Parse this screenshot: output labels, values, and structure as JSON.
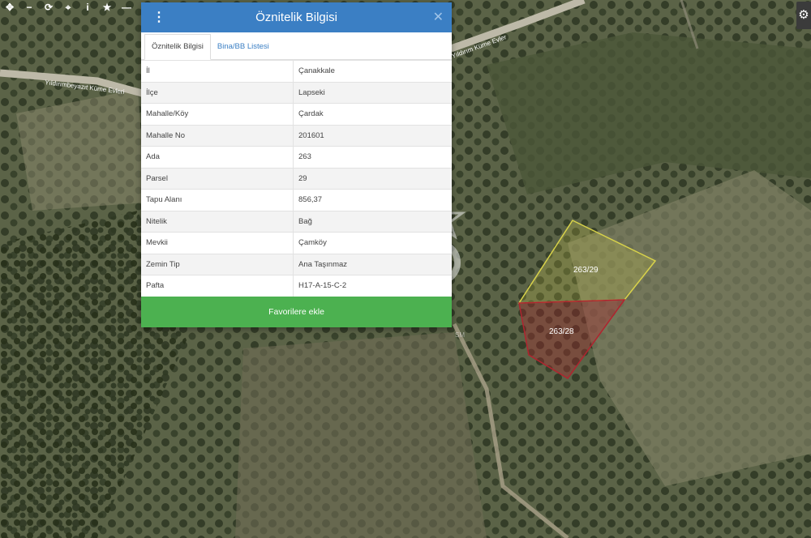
{
  "map": {
    "road_labels": [
      "Yıldırımbeyazıt Küme Evleri",
      "Yıldırım Küme Evler"
    ],
    "parcels": [
      {
        "label": "263/29",
        "color": "#d8d24a"
      },
      {
        "label": "263/28",
        "color": "#b0242f"
      }
    ],
    "watermark": {
      "text": "SM"
    }
  },
  "toolbar": {
    "icons": [
      "arrows-icon",
      "zoom-out-icon",
      "refresh-icon",
      "locate-icon",
      "info-icon",
      "star-icon",
      "measure-icon",
      "pin-icon"
    ],
    "glyphs": [
      "✥",
      "−",
      "⟳",
      "⌖",
      "i",
      "★",
      "—",
      "⚲"
    ]
  },
  "settings": {
    "glyph": "⚙"
  },
  "dialog": {
    "title": "Öznitelik Bilgisi",
    "menu_glyph": "⋮",
    "close_glyph": "✕",
    "tabs": [
      "Öznitelik Bilgisi",
      "Bina/BB Listesi"
    ],
    "rows": [
      {
        "label": "İl",
        "value": "Çanakkale"
      },
      {
        "label": "İlçe",
        "value": "Lapseki"
      },
      {
        "label": "Mahalle/Köy",
        "value": "Çardak"
      },
      {
        "label": "Mahalle No",
        "value": "201601"
      },
      {
        "label": "Ada",
        "value": "263"
      },
      {
        "label": "Parsel",
        "value": "29"
      },
      {
        "label": "Tapu Alanı",
        "value": "856,37"
      },
      {
        "label": "Nitelik",
        "value": "Bağ"
      },
      {
        "label": "Mevkii",
        "value": "Çamköy"
      },
      {
        "label": "Zemin Tip",
        "value": "Ana Taşınmaz"
      },
      {
        "label": "Pafta",
        "value": "H17-A-15-C-2"
      }
    ],
    "favorite_button": "Favorilere ekle"
  }
}
